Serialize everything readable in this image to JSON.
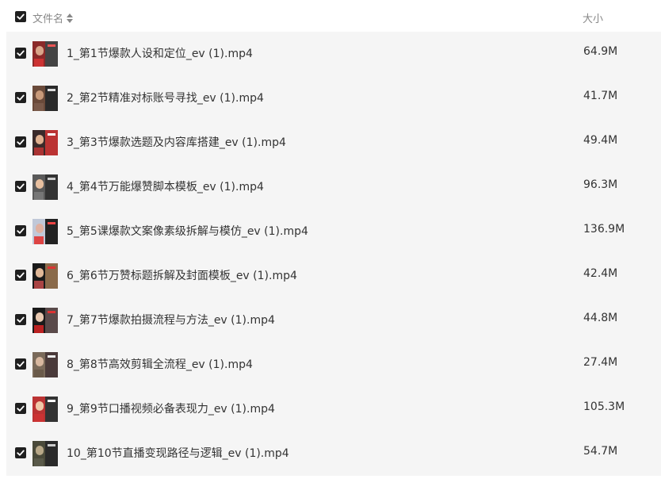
{
  "header": {
    "name_label": "文件名",
    "size_label": "大小"
  },
  "files": [
    {
      "name": "1_第1节爆款人设和定位_ev (1).mp4",
      "size": "64.9M"
    },
    {
      "name": "2_第2节精准对标账号寻找_ev (1).mp4",
      "size": "41.7M"
    },
    {
      "name": "3_第3节爆款选题及内容库搭建_ev (1).mp4",
      "size": "49.4M"
    },
    {
      "name": "4_第4节万能爆赞脚本模板_ev (1).mp4",
      "size": "96.3M"
    },
    {
      "name": "5_第5课爆款文案像素级拆解与模仿_ev (1).mp4",
      "size": "136.9M"
    },
    {
      "name": "6_第6节万赞标题拆解及封面模板_ev (1).mp4",
      "size": "42.4M"
    },
    {
      "name": "7_第7节爆款拍摄流程与方法_ev (1).mp4",
      "size": "44.8M"
    },
    {
      "name": "8_第8节高效剪辑全流程_ev (1).mp4",
      "size": "27.4M"
    },
    {
      "name": "9_第9节口播视频必备表现力_ev (1).mp4",
      "size": "105.3M"
    },
    {
      "name": "10_第10节直播变现路径与逻辑_ev (1).mp4",
      "size": "54.7M"
    }
  ]
}
